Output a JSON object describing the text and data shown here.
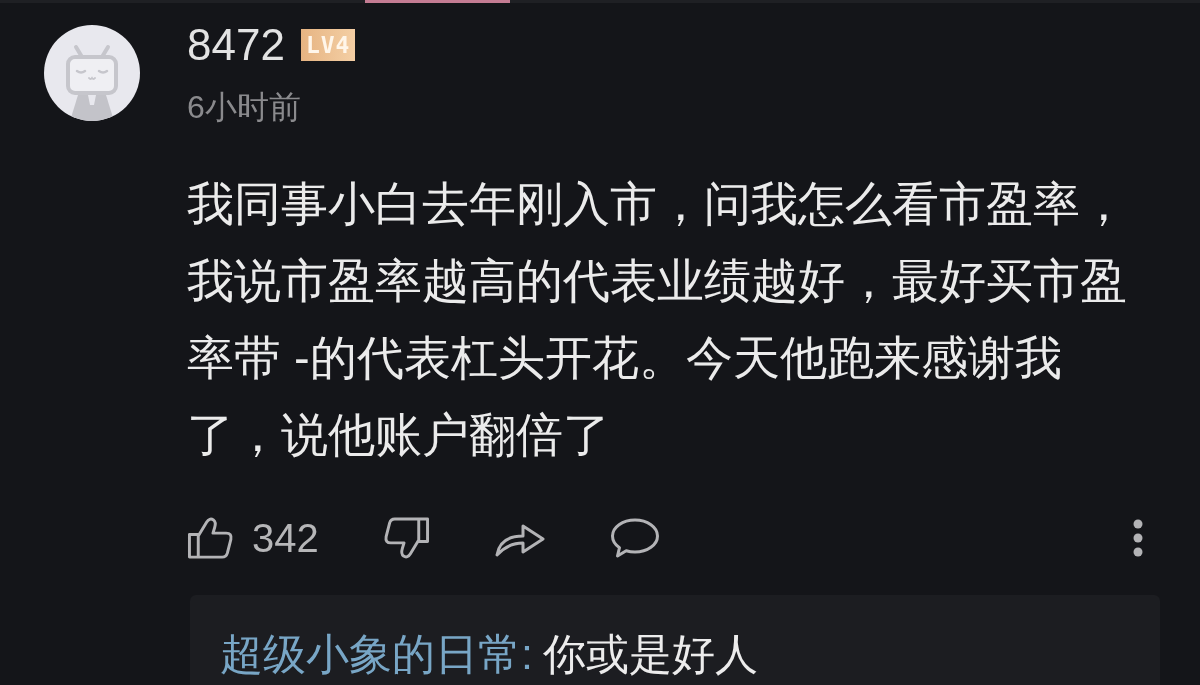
{
  "comment": {
    "username": "8472",
    "level_badge": "LV4",
    "time": "6小时前",
    "text": "我同事小白去年刚入市，问我怎么看市盈率，我说市盈率越高的代表业绩越好，最好买市盈率带 -的代表杠头开花。今天他跑来感谢我了，说他账户翻倍了",
    "like_count": "342"
  },
  "reply": {
    "author": "超级小象的日常:",
    "text": "你或是好人"
  }
}
